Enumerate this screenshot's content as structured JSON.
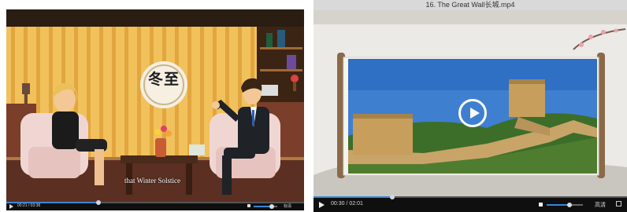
{
  "player_left": {
    "subtitle": "that Winter Solstice",
    "time": "00:21 / 03:38",
    "logo_text": "冬至",
    "progress": 0.31,
    "volume": 0.75,
    "quality_label": "标清"
  },
  "player_right": {
    "title": "16. The Great Wall长城.mp4",
    "time": "00:30 / 02:01",
    "progress": 0.25,
    "volume": 0.62,
    "quality_label": "高清"
  },
  "icons": {
    "play": "play-icon",
    "volume": "volume-icon",
    "fullscreen": "fullscreen-icon",
    "big_play": "play-circle-icon"
  },
  "colors": {
    "accent": "#3a86d8",
    "bar": "#0f0f0f"
  }
}
